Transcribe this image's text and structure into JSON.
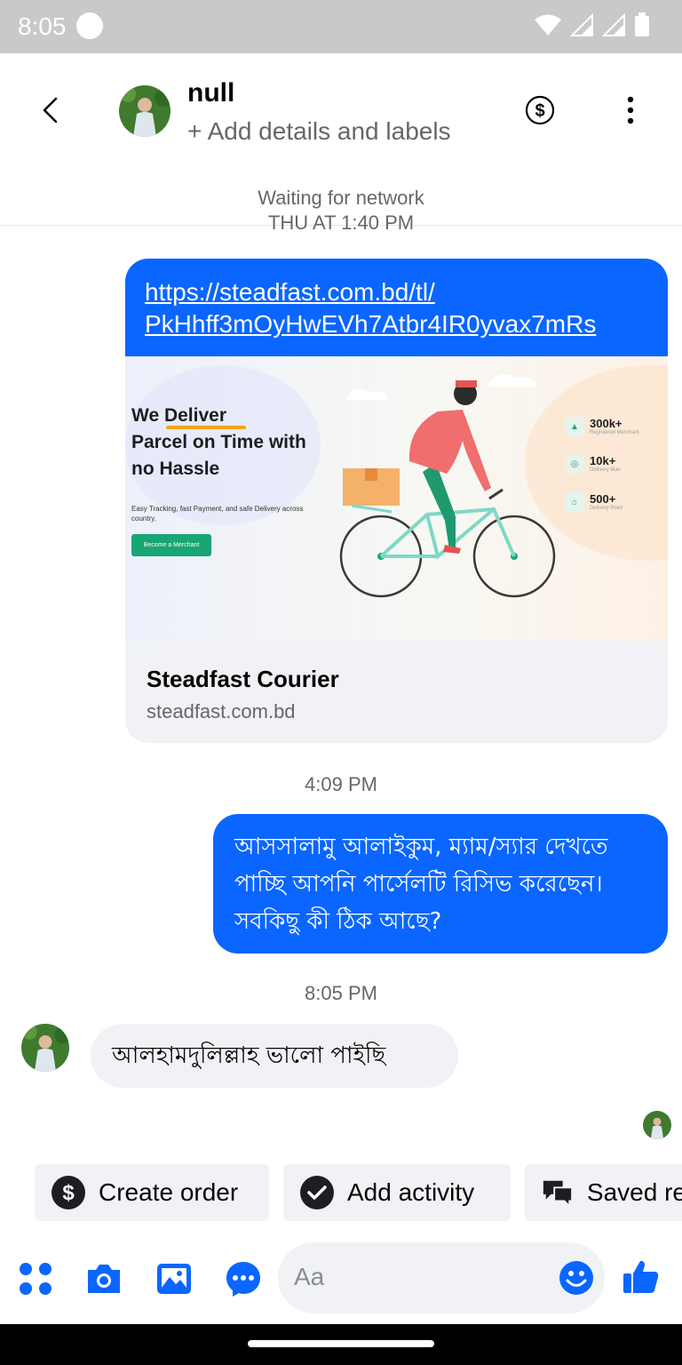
{
  "status_bar": {
    "time": "8:05"
  },
  "header": {
    "contact_name": "null",
    "subtitle": "+ Add details and labels",
    "network_status": "Waiting for network"
  },
  "chat": {
    "cut_timestamp": "THU AT 1:40 PM",
    "link_message": {
      "url_line1": "https://steadfast.com.bd/tl/",
      "url_line2": "PkHhff3mOyHwEVh7Atbr4IR0yvax7mRs",
      "preview_title": "Steadfast Courier",
      "preview_domain": "steadfast.com.bd",
      "image": {
        "heading_word1": "We Deliver",
        "heading_line2": "Parcel on Time with",
        "heading_line3": "no Hassle",
        "tagline": "Easy Tracking, fast Payment, and safe Delivery across country.",
        "cta": "Become a Merchant",
        "stats": [
          {
            "value": "300k+",
            "label": "Registered Merchant"
          },
          {
            "value": "10k+",
            "label": "Delivery Man"
          },
          {
            "value": "500+",
            "label": "Delivery Point"
          }
        ]
      }
    },
    "timestamp_1": "4:09 PM",
    "outgoing_text": "আসসালামু আলাইকুম, ম্যাম/স্যার দেখতে পাচ্ছি আপনি পার্সেলটি রিসিভ করেছেন। সবকিছু কী ঠিক আছে?",
    "timestamp_2": "8:05 PM",
    "incoming_text": "আলহামদুলিল্লাহ ভালো পাইছি"
  },
  "quick_actions": [
    {
      "label": "Create order",
      "icon": "dollar-circle-icon"
    },
    {
      "label": "Add activity",
      "icon": "check-circle-icon"
    },
    {
      "label": "Saved re",
      "icon": "chat-bubbles-icon"
    }
  ],
  "composer": {
    "placeholder": "Aa"
  },
  "colors": {
    "accent": "#0a66ff",
    "bubble_in": "#f0f2f5",
    "text_secondary": "#65676b"
  }
}
